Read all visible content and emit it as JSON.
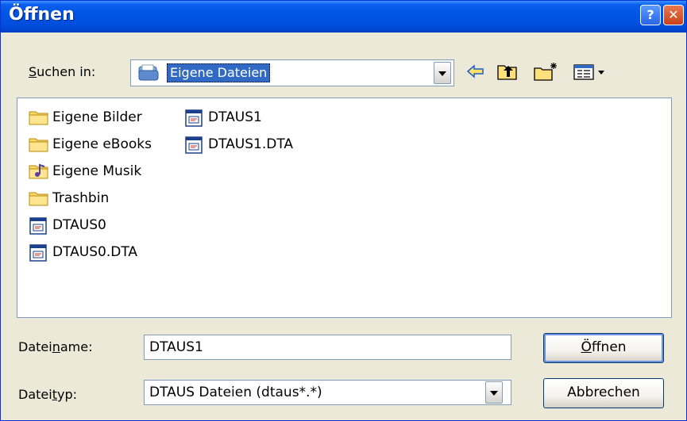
{
  "window": {
    "title": "Öffnen",
    "help_label": "?",
    "close_label": "✕"
  },
  "lookin": {
    "label_u": "S",
    "label_rest": "uchen in:",
    "value": "Eigene Dateien"
  },
  "toolbar": {
    "icons": [
      "back-arrow-icon",
      "up-folder-icon",
      "new-folder-icon",
      "view-menu-icon"
    ]
  },
  "files": [
    {
      "name": "Eigene Bilder",
      "icon": "folder-icon",
      "col": 0,
      "row": 0
    },
    {
      "name": "Eigene eBooks",
      "icon": "folder-icon",
      "col": 0,
      "row": 1
    },
    {
      "name": "Eigene Musik",
      "icon": "music-folder-icon",
      "col": 0,
      "row": 2
    },
    {
      "name": "Trashbin",
      "icon": "folder-icon",
      "col": 0,
      "row": 3
    },
    {
      "name": "DTAUS0",
      "icon": "file-icon",
      "col": 0,
      "row": 4
    },
    {
      "name": "DTAUS0.DTA",
      "icon": "file-icon",
      "col": 0,
      "row": 5
    },
    {
      "name": "DTAUS1",
      "icon": "file-icon",
      "col": 1,
      "row": 0
    },
    {
      "name": "DTAUS1.DTA",
      "icon": "file-icon",
      "col": 1,
      "row": 1
    }
  ],
  "filename": {
    "label_a": "Datei",
    "label_u": "n",
    "label_b": "ame:",
    "value": "DTAUS1"
  },
  "filetype": {
    "label_a": "Datei",
    "label_u": "t",
    "label_b": "yp:",
    "value": "DTAUS Dateien (dtaus*.*)"
  },
  "buttons": {
    "open_u": "Ö",
    "open_rest": "ffnen",
    "cancel": "Abbrechen"
  }
}
